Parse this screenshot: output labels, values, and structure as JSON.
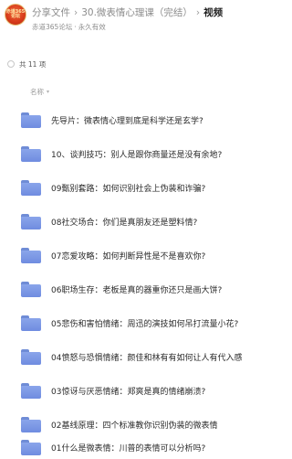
{
  "header": {
    "logo_text": "赤道365论坛",
    "breadcrumb": [
      "分享文件",
      "30.微表情心理课（完结）",
      "视频"
    ],
    "separator": "›",
    "source": "赤道365论坛",
    "validity": "永久有效",
    "dot": "·"
  },
  "list": {
    "count_label": "共 11 项",
    "column_name": "名称",
    "sort_icon": "caret-down-icon",
    "items": [
      "先导片：微表情心理到底是科学还是玄学?",
      "10、谈判技巧：别人是跟你商量还是没有余地?",
      "09甄别套路：如何识别社会上伪装和诈骗?",
      "08社交场合：你们是真朋友还是塑料情?",
      "07恋爱攻略：如何判断异性是不是喜欢你?",
      "06职场生存：老板是真的器重你还只是画大饼?",
      "05悲伤和害怕情绪：周迅的演技如何吊打流量小花?",
      "04愤怒与恐惧情绪：颜佳和林有有如何让人有代入感",
      "03惊讶与厌恶情绪：郑爽是真的情绪崩溃?",
      "02基线原理：四个标准教你识别伪装的微表情",
      "01什么是微表情：川普的表情可以分析吗?"
    ]
  },
  "colors": {
    "folder": "#7390e2",
    "breadcrumb_current": "#1f1f1f",
    "muted": "#8c8c8c"
  }
}
